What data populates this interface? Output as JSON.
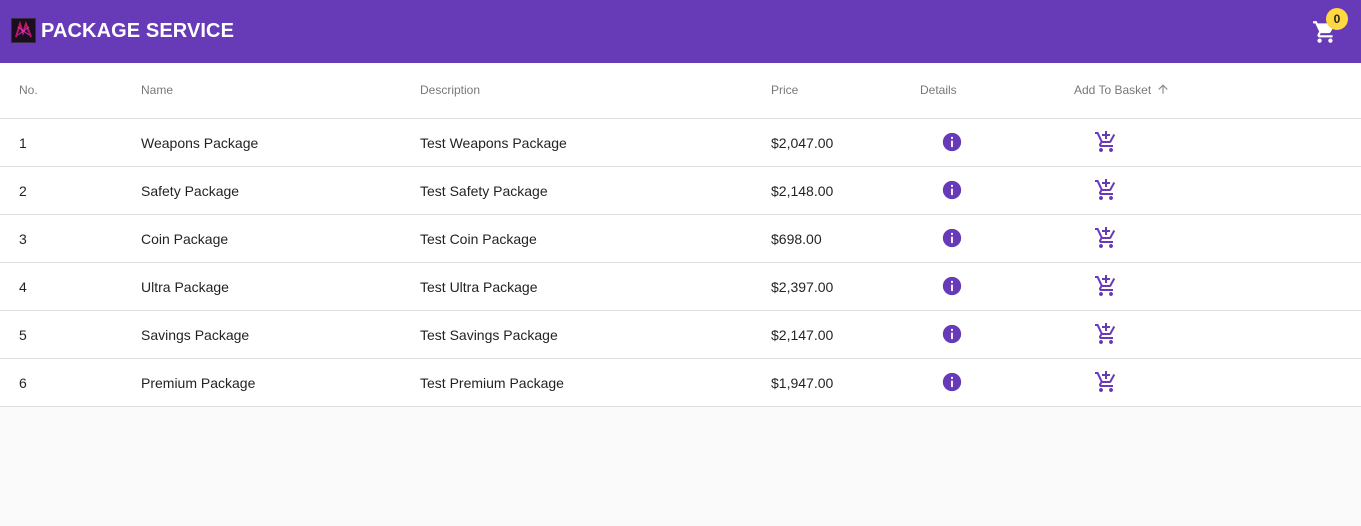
{
  "app": {
    "title": "PACKAGE SERVICE",
    "cart_count": "0",
    "brand_color": "#673ab7",
    "badge_color": "#ffd740"
  },
  "table": {
    "headers": {
      "no": "No.",
      "name": "Name",
      "description": "Description",
      "price": "Price",
      "details": "Details",
      "add_to_basket": "Add To Basket"
    },
    "sort": {
      "column": "add_to_basket",
      "direction": "ascending",
      "icon": "arrow-up-icon"
    },
    "rows": [
      {
        "no": "1",
        "name": "Weapons Package",
        "description": "Test Weapons Package",
        "price": "$2,047.00"
      },
      {
        "no": "2",
        "name": "Safety Package",
        "description": "Test Safety Package",
        "price": "$2,148.00"
      },
      {
        "no": "3",
        "name": "Coin Package",
        "description": "Test Coin Package",
        "price": "$698.00"
      },
      {
        "no": "4",
        "name": "Ultra Package",
        "description": "Test Ultra Package",
        "price": "$2,397.00"
      },
      {
        "no": "5",
        "name": "Savings Package",
        "description": "Test Savings Package",
        "price": "$2,147.00"
      },
      {
        "no": "6",
        "name": "Premium Package",
        "description": "Test Premium Package",
        "price": "$1,947.00"
      }
    ],
    "row_icons": {
      "details": "info-icon",
      "add": "add-shopping-cart-icon"
    }
  }
}
